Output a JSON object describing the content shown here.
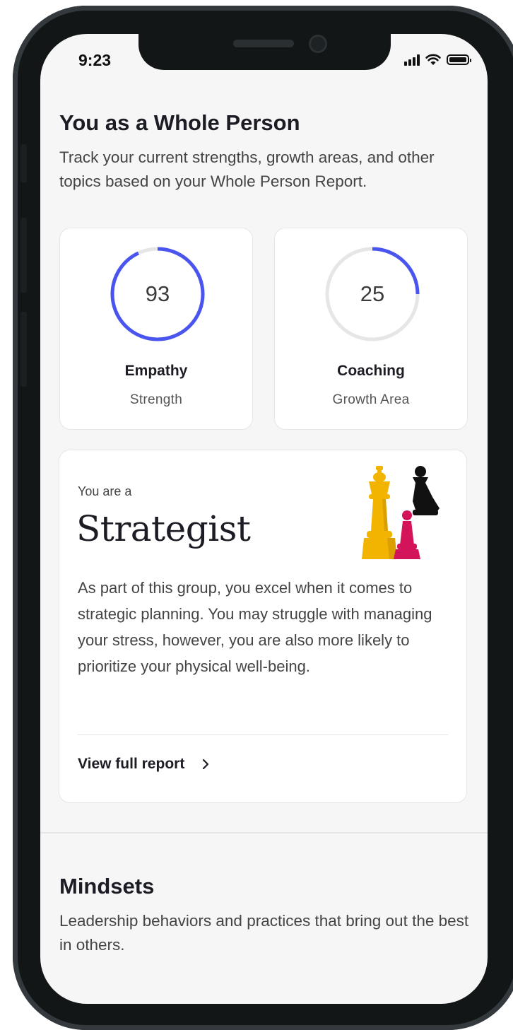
{
  "status_bar": {
    "time": "9:23",
    "signal_icon": "cellular-signal-icon",
    "wifi_icon": "wifi-icon",
    "battery_icon": "battery-icon"
  },
  "whole_person": {
    "title": "You as a Whole Person",
    "description": "Track your current strengths, growth areas, and other topics based on your Whole Person Report."
  },
  "metrics": [
    {
      "value": "93",
      "progress": 0.93,
      "name": "Empathy",
      "type": "Strength",
      "color": "#4a55f0"
    },
    {
      "value": "25",
      "progress": 0.25,
      "name": "Coaching",
      "type": "Growth Area",
      "color": "#4a55f0"
    }
  ],
  "persona": {
    "intro": "You are a",
    "name": "Strategist",
    "illustration": "chess-pieces-illustration",
    "description": "As part of this group, you excel when it comes to strategic planning. You may struggle with managing your stress, however, you are also more likely to prioritize your physical well-being.",
    "link_label": "View full report",
    "link_icon": "chevron-right-icon"
  },
  "mindsets": {
    "title": "Mindsets",
    "description": "Leadership behaviors and practices that bring out the best in others."
  },
  "colors": {
    "accent": "#4a55f0",
    "track": "#e6e6e6",
    "background": "#f6f6f6",
    "text": "#1c1c24"
  }
}
